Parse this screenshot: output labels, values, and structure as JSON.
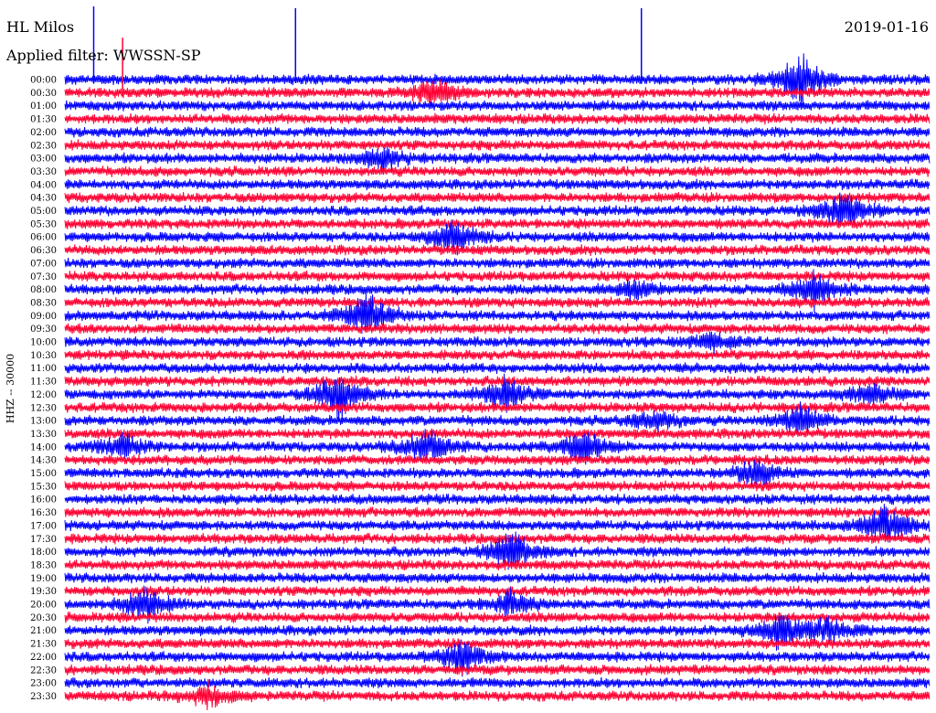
{
  "header": {
    "station": "HL Milos",
    "date": "2019-01-16",
    "filter_label": "Applied filter: WWSSN-SP"
  },
  "chart_data": {
    "type": "line",
    "title": "HL Milos",
    "ylabel": "HHZ -- 30000",
    "y_tick_labels": [
      "00:00",
      "00:30",
      "01:00",
      "01:30",
      "02:00",
      "02:30",
      "03:00",
      "03:30",
      "04:00",
      "04:30",
      "05:00",
      "05:30",
      "06:00",
      "06:30",
      "07:00",
      "07:30",
      "08:00",
      "08:30",
      "09:00",
      "09:30",
      "10:00",
      "10:30",
      "11:00",
      "11:30",
      "12:00",
      "12:30",
      "13:00",
      "13:30",
      "14:00",
      "14:30",
      "15:00",
      "15:30",
      "16:00",
      "16:30",
      "17:00",
      "17:30",
      "18:00",
      "18:30",
      "19:00",
      "19:30",
      "20:00",
      "20:30",
      "21:00",
      "21:30",
      "22:00",
      "22:30",
      "23:00",
      "23:30"
    ],
    "x_range_minutes": [
      0,
      30
    ],
    "trace_colors": [
      "#0000ff",
      "#ff0033"
    ],
    "events": [
      {
        "row": 0,
        "minute": 25.5,
        "amplitude": 3.0
      },
      {
        "row": 1,
        "minute": 12.8,
        "amplitude": 1.8
      },
      {
        "row": 6,
        "minute": 11.0,
        "amplitude": 1.5
      },
      {
        "row": 10,
        "minute": 27.0,
        "amplitude": 2.2
      },
      {
        "row": 12,
        "minute": 13.5,
        "amplitude": 2.0
      },
      {
        "row": 16,
        "minute": 19.7,
        "amplitude": 1.0
      },
      {
        "row": 16,
        "minute": 26.0,
        "amplitude": 2.0
      },
      {
        "row": 18,
        "minute": 10.5,
        "amplitude": 2.5
      },
      {
        "row": 20,
        "minute": 22.5,
        "amplitude": 1.0
      },
      {
        "row": 24,
        "minute": 9.5,
        "amplitude": 2.5
      },
      {
        "row": 24,
        "minute": 15.3,
        "amplitude": 2.0
      },
      {
        "row": 24,
        "minute": 28.0,
        "amplitude": 1.2
      },
      {
        "row": 26,
        "minute": 20.5,
        "amplitude": 1.2
      },
      {
        "row": 26,
        "minute": 25.5,
        "amplitude": 1.8
      },
      {
        "row": 28,
        "minute": 2.0,
        "amplitude": 1.5
      },
      {
        "row": 28,
        "minute": 12.5,
        "amplitude": 2.0
      },
      {
        "row": 28,
        "minute": 18.0,
        "amplitude": 2.0
      },
      {
        "row": 30,
        "minute": 24.0,
        "amplitude": 1.5
      },
      {
        "row": 34,
        "minute": 28.5,
        "amplitude": 2.5
      },
      {
        "row": 36,
        "minute": 15.5,
        "amplitude": 2.5
      },
      {
        "row": 40,
        "minute": 2.8,
        "amplitude": 2.0
      },
      {
        "row": 40,
        "minute": 15.5,
        "amplitude": 1.5
      },
      {
        "row": 42,
        "minute": 24.8,
        "amplitude": 2.0
      },
      {
        "row": 42,
        "minute": 26.5,
        "amplitude": 1.5
      },
      {
        "row": 44,
        "minute": 13.8,
        "amplitude": 2.0
      },
      {
        "row": 47,
        "minute": 5.0,
        "amplitude": 1.2
      }
    ],
    "spikes": [
      {
        "row": 0,
        "minute": 1.0,
        "height": 80
      },
      {
        "row": 0,
        "minute": 8.0,
        "height": 78
      },
      {
        "row": 0,
        "minute": 20.0,
        "height": 78
      },
      {
        "row": 1,
        "minute": 2.0,
        "height": 60
      }
    ]
  }
}
